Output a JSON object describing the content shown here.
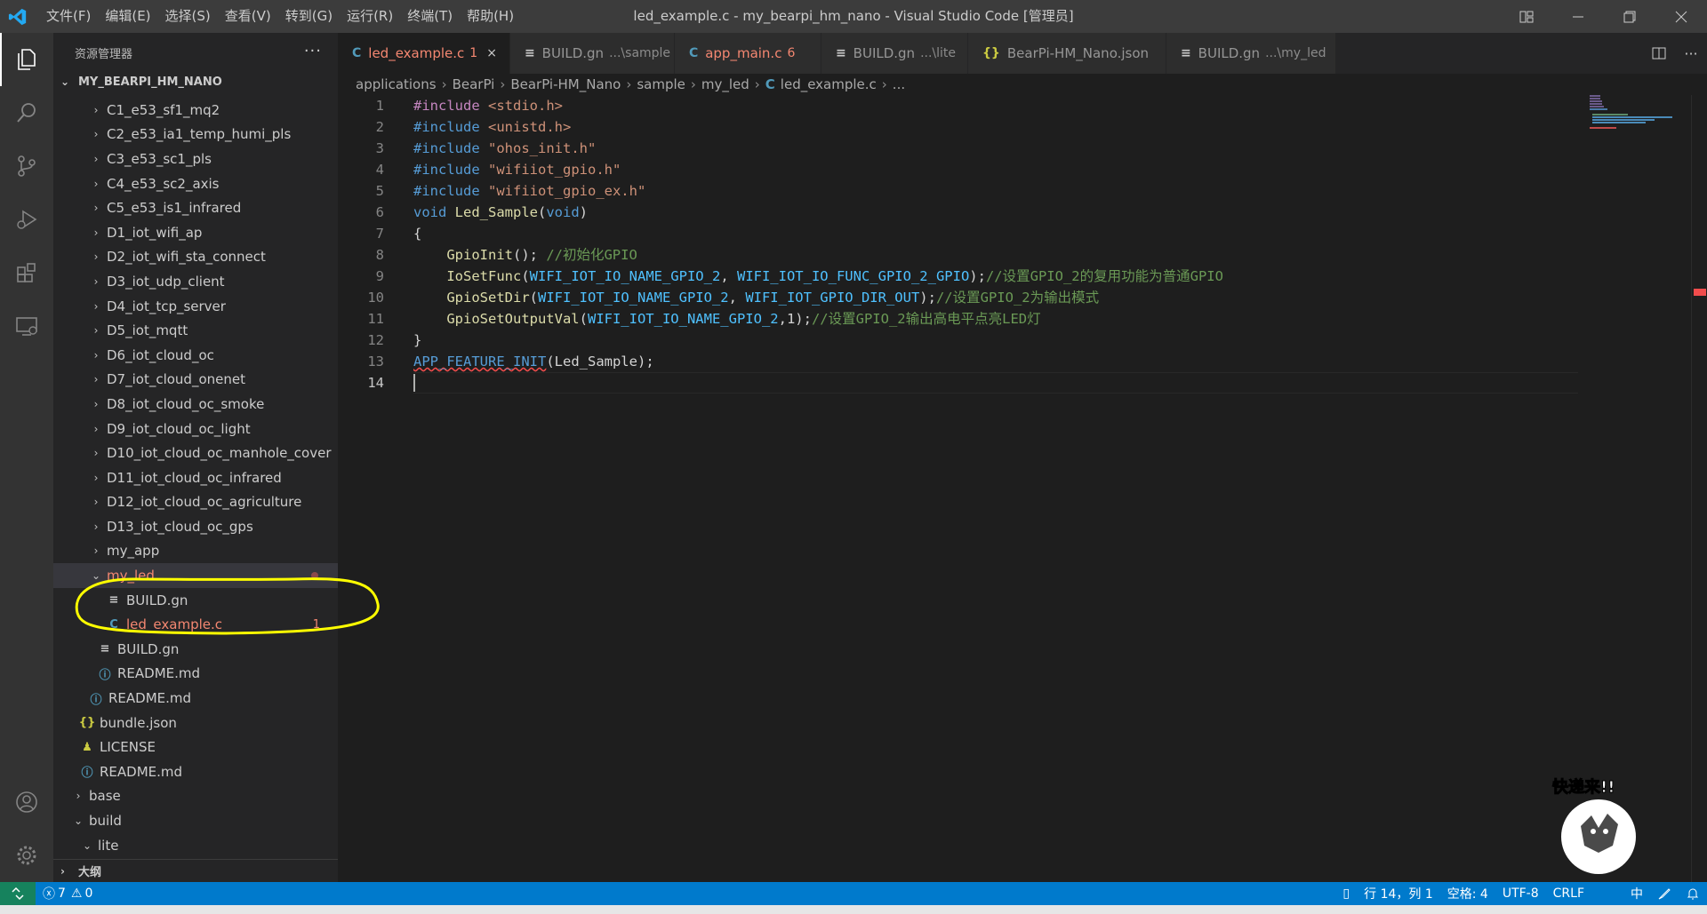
{
  "window": {
    "title": "led_example.c - my_bearpi_hm_nano - Visual Studio Code [管理员]",
    "menu": [
      "文件(F)",
      "编辑(E)",
      "选择(S)",
      "查看(V)",
      "转到(G)",
      "运行(R)",
      "终端(T)",
      "帮助(H)"
    ]
  },
  "sidebar": {
    "title": "资源管理器",
    "more": "···",
    "root": "MY_BEARPI_HM_NANO",
    "outline": "大纲",
    "rows": [
      {
        "label": "C1_e53_sf1_mq2",
        "chev": "›",
        "icon": ""
      },
      {
        "label": "C2_e53_ia1_temp_humi_pls",
        "chev": "›",
        "icon": ""
      },
      {
        "label": "C3_e53_sc1_pls",
        "chev": "›",
        "icon": ""
      },
      {
        "label": "C4_e53_sc2_axis",
        "chev": "›",
        "icon": ""
      },
      {
        "label": "C5_e53_is1_infrared",
        "chev": "›",
        "icon": ""
      },
      {
        "label": "D1_iot_wifi_ap",
        "chev": "›",
        "icon": ""
      },
      {
        "label": "D2_iot_wifi_sta_connect",
        "chev": "›",
        "icon": ""
      },
      {
        "label": "D3_iot_udp_client",
        "chev": "›",
        "icon": ""
      },
      {
        "label": "D4_iot_tcp_server",
        "chev": "›",
        "icon": ""
      },
      {
        "label": "D5_iot_mqtt",
        "chev": "›",
        "icon": ""
      },
      {
        "label": "D6_iot_cloud_oc",
        "chev": "›",
        "icon": ""
      },
      {
        "label": "D7_iot_cloud_onenet",
        "chev": "›",
        "icon": ""
      },
      {
        "label": "D8_iot_cloud_oc_smoke",
        "chev": "›",
        "icon": ""
      },
      {
        "label": "D9_iot_cloud_oc_light",
        "chev": "›",
        "icon": ""
      },
      {
        "label": "D10_iot_cloud_oc_manhole_cover",
        "chev": "›",
        "icon": ""
      },
      {
        "label": "D11_iot_cloud_oc_infrared",
        "chev": "›",
        "icon": ""
      },
      {
        "label": "D12_iot_cloud_oc_agriculture",
        "chev": "›",
        "icon": ""
      },
      {
        "label": "D13_iot_cloud_oc_gps",
        "chev": "›",
        "icon": ""
      },
      {
        "label": "my_app",
        "chev": "›",
        "icon": ""
      },
      {
        "label": "my_led",
        "chev": "⌄",
        "icon": ""
      },
      {
        "label": "BUILD.gn",
        "chev": "",
        "icon": "≡"
      },
      {
        "label": "led_example.c",
        "chev": "",
        "icon": "C",
        "badge": "1"
      },
      {
        "label": "BUILD.gn",
        "chev": "",
        "icon": "≡"
      },
      {
        "label": "README.md",
        "chev": "",
        "icon": "ⓘ"
      },
      {
        "label": "README.md",
        "chev": "",
        "icon": "ⓘ"
      },
      {
        "label": "bundle.json",
        "chev": "",
        "icon": "{}"
      },
      {
        "label": "LICENSE",
        "chev": "",
        "icon": "♟"
      },
      {
        "label": "README.md",
        "chev": "",
        "icon": "ⓘ"
      },
      {
        "label": "base",
        "chev": "›",
        "icon": ""
      },
      {
        "label": "build",
        "chev": "⌄",
        "icon": ""
      },
      {
        "label": "lite",
        "chev": "⌄",
        "icon": ""
      }
    ]
  },
  "tabs": [
    {
      "icon": "C",
      "name": "led_example.c",
      "desc": "",
      "badge": "1",
      "close": "×"
    },
    {
      "icon": "≡",
      "name": "BUILD.gn",
      "desc": "...\\sample",
      "badge": "",
      "close": ""
    },
    {
      "icon": "C",
      "name": "app_main.c",
      "desc": "",
      "badge": "6",
      "close": ""
    },
    {
      "icon": "≡",
      "name": "BUILD.gn",
      "desc": "...\\lite",
      "badge": "",
      "close": ""
    },
    {
      "icon": "{}",
      "name": "BearPi-HM_Nano.json",
      "desc": "",
      "badge": "",
      "close": ""
    },
    {
      "icon": "≡",
      "name": "BUILD.gn",
      "desc": "...\\my_led",
      "badge": "",
      "close": ""
    }
  ],
  "breadcrumb": {
    "items": [
      "applications",
      "BearPi",
      "BearPi-HM_Nano",
      "sample",
      "my_led"
    ],
    "file_icon": "C",
    "file": "led_example.c",
    "tail": "..."
  },
  "editor": {
    "line_numbers": [
      "1",
      "2",
      "3",
      "4",
      "5",
      "6",
      "7",
      "8",
      "9",
      "10",
      "11",
      "12",
      "13",
      "14"
    ],
    "code": {
      "l1_kw": "#include",
      "l1_str": "<stdio.h>",
      "l2_kw": "#include",
      "l2_str": "<unistd.h>",
      "l3_kw": "#include",
      "l3_str": "\"ohos_init.h\"",
      "l4_kw": "#include",
      "l4_str": "\"wifiiot_gpio.h\"",
      "l5_kw": "#include",
      "l5_str": "\"wifiiot_gpio_ex.h\"",
      "l6_kw": "void",
      "l6_fn": "Led_Sample",
      "l6_p1": "(",
      "l6_arg": "void",
      "l6_p2": ")",
      "l7": "{",
      "l8_fn": "GpioInit",
      "l8_pl": "(); ",
      "l8_cm": "//初始化GPIO",
      "l9_fn": "IoSetFunc",
      "l9_p1": "(",
      "l9_c1": "WIFI_IOT_IO_NAME_GPIO_2",
      "l9_p2": ", ",
      "l9_c2": "WIFI_IOT_IO_FUNC_GPIO_2_GPIO",
      "l9_p3": ");",
      "l9_cm": "//设置GPIO_2的复用功能为普通GPIO",
      "l10_fn": "GpioSetDir",
      "l10_p1": "(",
      "l10_c1": "WIFI_IOT_IO_NAME_GPIO_2",
      "l10_p2": ", ",
      "l10_c2": "WIFI_IOT_GPIO_DIR_OUT",
      "l10_p3": ");",
      "l10_cm": "//设置GPIO_2为输出模式",
      "l11_fn": "GpioSetOutputVal",
      "l11_p1": "(",
      "l11_c1": "WIFI_IOT_IO_NAME_GPIO_2",
      "l11_p2": ",1);",
      "l11_cm": "//设置GPIO_2输出高电平点亮LED灯",
      "l12": "}",
      "l13_mac": "APP_FEATURE_INIT",
      "l13_p1": "(",
      "l13_fn": "Led_Sample",
      "l13_p2": ");"
    }
  },
  "statusbar": {
    "errors": "7",
    "warnings": "0",
    "position": "行 14，列 1",
    "spaces": "空格: 4",
    "encoding": "UTF-8",
    "eol": "CRLF",
    "ime": "中"
  },
  "annotation": {
    "sticker_text": "快递来!!"
  },
  "colors": {
    "accent": "#007acc",
    "error": "#f48771",
    "highlight": "#ffff00"
  }
}
